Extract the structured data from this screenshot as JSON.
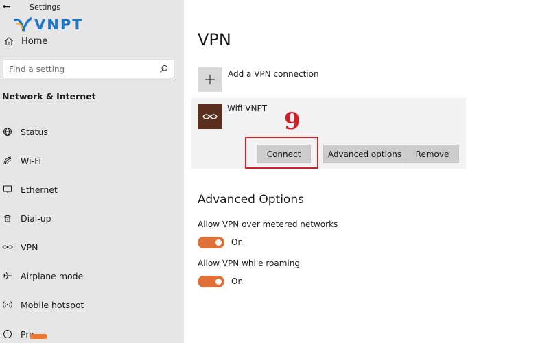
{
  "window": {
    "title": "Settings"
  },
  "logo": {
    "text": "VNPT"
  },
  "sidebar": {
    "home_label": "Home",
    "search": {
      "placeholder": "Find a setting"
    },
    "section_title": "Network & Internet",
    "items": [
      {
        "label": "Status",
        "icon": "globe-icon"
      },
      {
        "label": "Wi-Fi",
        "icon": "wifi-icon"
      },
      {
        "label": "Ethernet",
        "icon": "ethernet-icon"
      },
      {
        "label": "Dial-up",
        "icon": "dialup-icon"
      },
      {
        "label": "VPN",
        "icon": "vpn-icon"
      },
      {
        "label": "Airplane mode",
        "icon": "airplane-icon"
      },
      {
        "label": "Mobile hotspot",
        "icon": "hotspot-icon"
      },
      {
        "label": "Pro",
        "icon": "proxy-icon"
      }
    ]
  },
  "main": {
    "title": "VPN",
    "add_connection_label": "Add a VPN connection",
    "connection": {
      "name": "Wifi VNPT",
      "buttons": {
        "connect": "Connect",
        "advanced": "Advanced options",
        "remove": "Remove"
      }
    },
    "annotation": {
      "step": "9",
      "color": "#d11f2a"
    },
    "advanced": {
      "title": "Advanced Options",
      "options": [
        {
          "label": "Allow VPN over metered networks",
          "state": "On"
        },
        {
          "label": "Allow VPN while roaming",
          "state": "On"
        }
      ]
    }
  },
  "colors": {
    "accent_toggle": "#e0703a",
    "logo_blue": "#1f77c9",
    "vpn_tile": "#5b2f1e"
  }
}
